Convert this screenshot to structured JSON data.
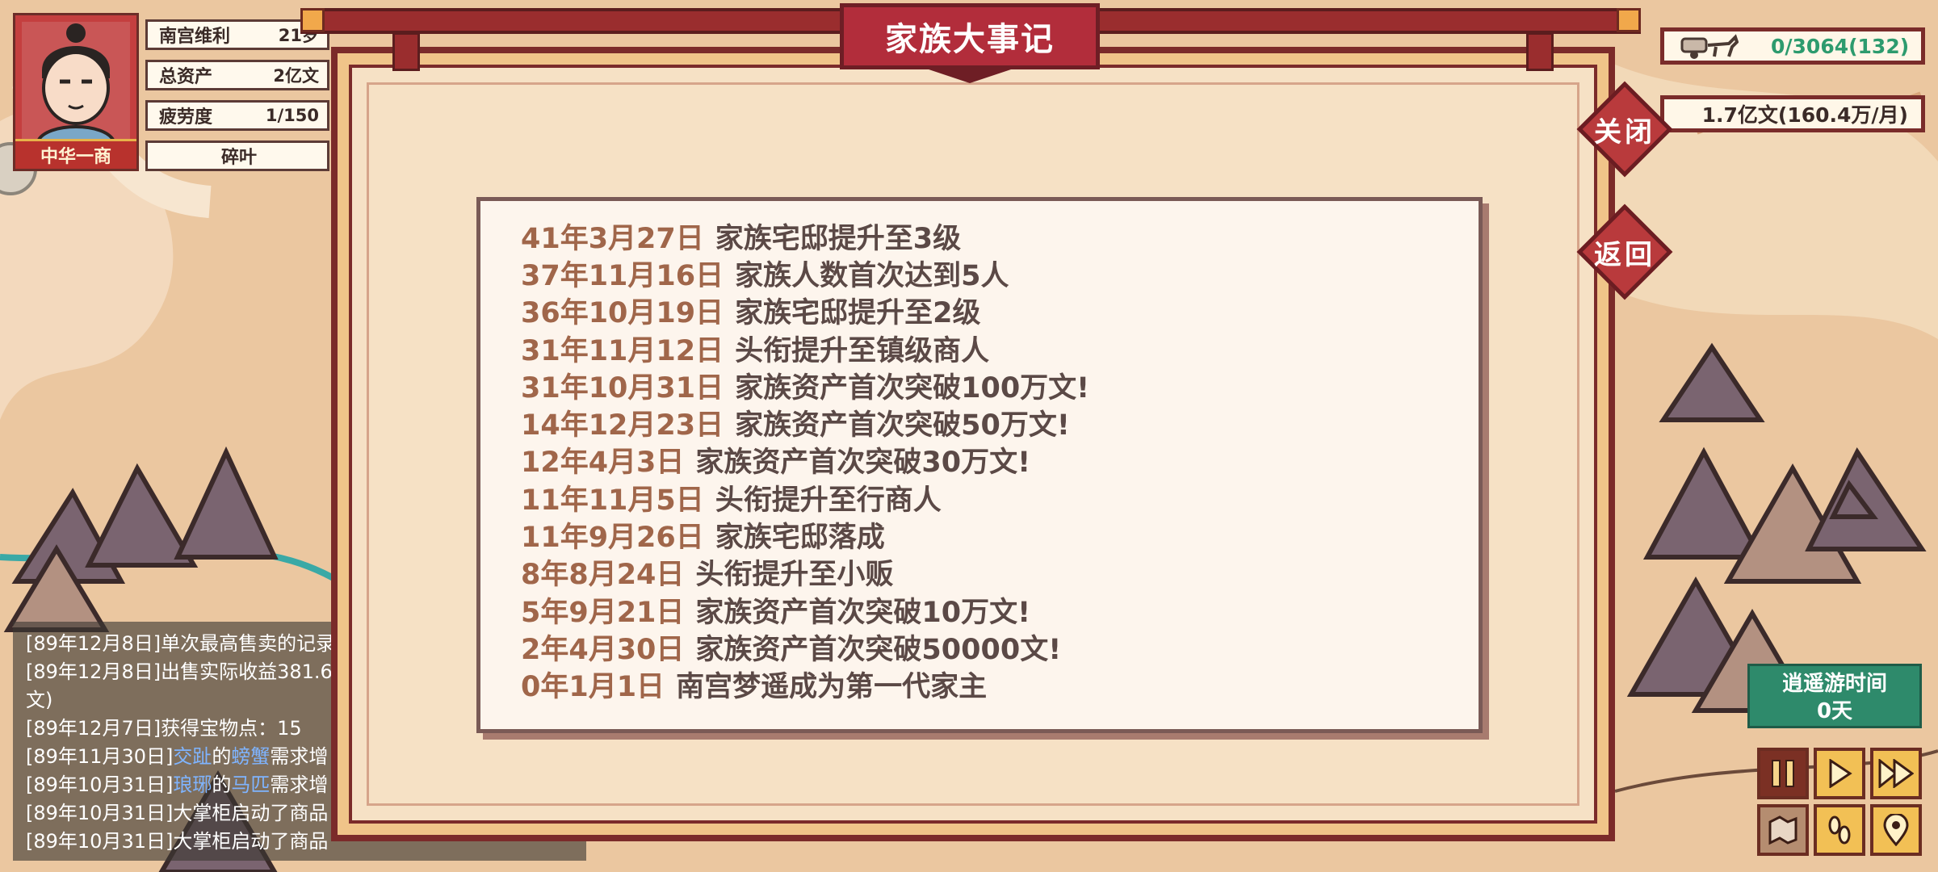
{
  "player": {
    "name": "南宫维利",
    "name_value": "21岁",
    "assets_label": "总资产",
    "assets_value": "2亿文",
    "fatigue_label": "疲劳度",
    "fatigue_value": "1/150",
    "title_badge": "中华一商",
    "location": "碎叶"
  },
  "top_right": {
    "cargo": "0/3064(132)",
    "money": "1.7亿文(160.4万/月)"
  },
  "modal": {
    "title": "家族大事记",
    "close_label": "关闭",
    "back_label": "返回",
    "events": [
      {
        "date": "41年3月27日",
        "text": "家族宅邸提升至3级"
      },
      {
        "date": "37年11月16日",
        "text": "家族人数首次达到5人"
      },
      {
        "date": "36年10月19日",
        "text": "家族宅邸提升至2级"
      },
      {
        "date": "31年11月12日",
        "text": "头衔提升至镇级商人"
      },
      {
        "date": "31年10月31日",
        "text": "家族资产首次突破100万文!"
      },
      {
        "date": "14年12月23日",
        "text": "家族资产首次突破50万文!"
      },
      {
        "date": "12年4月3日",
        "text": "家族资产首次突破30万文!"
      },
      {
        "date": "11年11月5日",
        "text": "头衔提升至行商人"
      },
      {
        "date": "11年9月26日",
        "text": "家族宅邸落成"
      },
      {
        "date": "8年8月24日",
        "text": "头衔提升至小贩"
      },
      {
        "date": "5年9月21日",
        "text": "家族资产首次突破10万文!"
      },
      {
        "date": "2年4月30日",
        "text": "家族资产首次突破50000文!"
      },
      {
        "date": "0年1月1日",
        "text": "南宫梦遥成为第一代家主"
      }
    ]
  },
  "log": {
    "lines": [
      {
        "segments": [
          {
            "text": "[89年12月8日]单次最高售卖的记录",
            "hl": false
          }
        ]
      },
      {
        "segments": [
          {
            "text": "[89年12月8日]出售实际收益381.6",
            "hl": false
          }
        ]
      },
      {
        "segments": [
          {
            "text": "文)",
            "hl": false
          }
        ]
      },
      {
        "segments": [
          {
            "text": "[89年12月7日]获得宝物点：15",
            "hl": false
          }
        ]
      },
      {
        "segments": [
          {
            "text": "[89年11月30日]",
            "hl": false
          },
          {
            "text": "交趾",
            "hl": true
          },
          {
            "text": "的",
            "hl": false
          },
          {
            "text": "螃蟹",
            "hl": true
          },
          {
            "text": "需求增",
            "hl": false
          }
        ]
      },
      {
        "segments": [
          {
            "text": "[89年10月31日]",
            "hl": false
          },
          {
            "text": "琅琊",
            "hl": true
          },
          {
            "text": "的",
            "hl": false
          },
          {
            "text": "马匹",
            "hl": true
          },
          {
            "text": "需求增",
            "hl": false
          }
        ]
      },
      {
        "segments": [
          {
            "text": "[89年10月31日]大掌柜启动了商品",
            "hl": false
          }
        ]
      },
      {
        "segments": [
          {
            "text": "[89年10月31日]大掌柜启动了商品",
            "hl": false
          }
        ]
      }
    ]
  },
  "leisure": {
    "label": "逍遥游时间",
    "value": "0天"
  },
  "controls": {
    "icons": [
      "pause-icon",
      "play-icon",
      "fast-forward-icon",
      "map-icon",
      "footprints-icon",
      "location-pin-icon"
    ]
  },
  "colors": {
    "frame_red": "#7b2b2a",
    "title_red": "#b22d3b",
    "event_date": "#a0664a",
    "event_text": "#5b4946",
    "accent_green": "#2d9b6e"
  }
}
